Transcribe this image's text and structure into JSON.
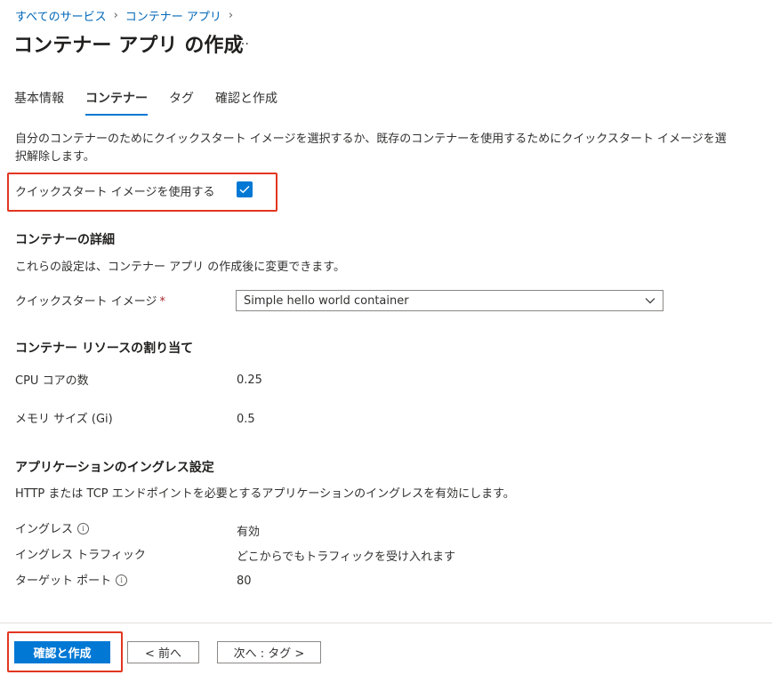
{
  "breadcrumb": {
    "items": [
      {
        "label": "すべてのサービス"
      },
      {
        "label": "コンテナー アプリ"
      }
    ],
    "separator": "›"
  },
  "page": {
    "title": "コンテナー アプリ の作成",
    "more_label": "…"
  },
  "tabs": [
    {
      "label": "基本情報",
      "active": false
    },
    {
      "label": "コンテナー",
      "active": true
    },
    {
      "label": "タグ",
      "active": false
    },
    {
      "label": "確認と作成",
      "active": false
    }
  ],
  "intro_text": "自分のコンテナーのためにクイックスタート イメージを選択するか、既存のコンテナーを使用するためにクイックスタート イメージを選択解除します。",
  "quickstart": {
    "label": "クイックスタート イメージを使用する",
    "checked": true
  },
  "container_details": {
    "heading": "コンテナーの詳細",
    "description": "これらの設定は、コンテナー アプリ の作成後に変更できます。",
    "image_label": "クイックスタート イメージ",
    "required_marker": "*",
    "image_value": "Simple hello world container"
  },
  "resources": {
    "heading": "コンテナー リソースの割り当て",
    "cpu_label": "CPU コアの数",
    "cpu_value": "0.25",
    "memory_label": "メモリ サイズ (Gi)",
    "memory_value": "0.5"
  },
  "ingress": {
    "heading": "アプリケーションのイングレス設定",
    "description": "HTTP または TCP エンドポイントを必要とするアプリケーションのイングレスを有効にします。",
    "ingress_label": "イングレス",
    "ingress_value": "有効",
    "traffic_label": "イングレス トラフィック",
    "traffic_value": "どこからでもトラフィックを受け入れます",
    "port_label": "ターゲット ポート",
    "port_value": "80",
    "info_glyph": "i"
  },
  "footer": {
    "review_create_label": "確認と作成",
    "prev_label": "< 前へ",
    "next_label": "次へ : タグ >"
  },
  "colors": {
    "accent": "#0078d4",
    "link": "#0067b8",
    "highlight": "#e2361f",
    "required": "#a4262c"
  }
}
